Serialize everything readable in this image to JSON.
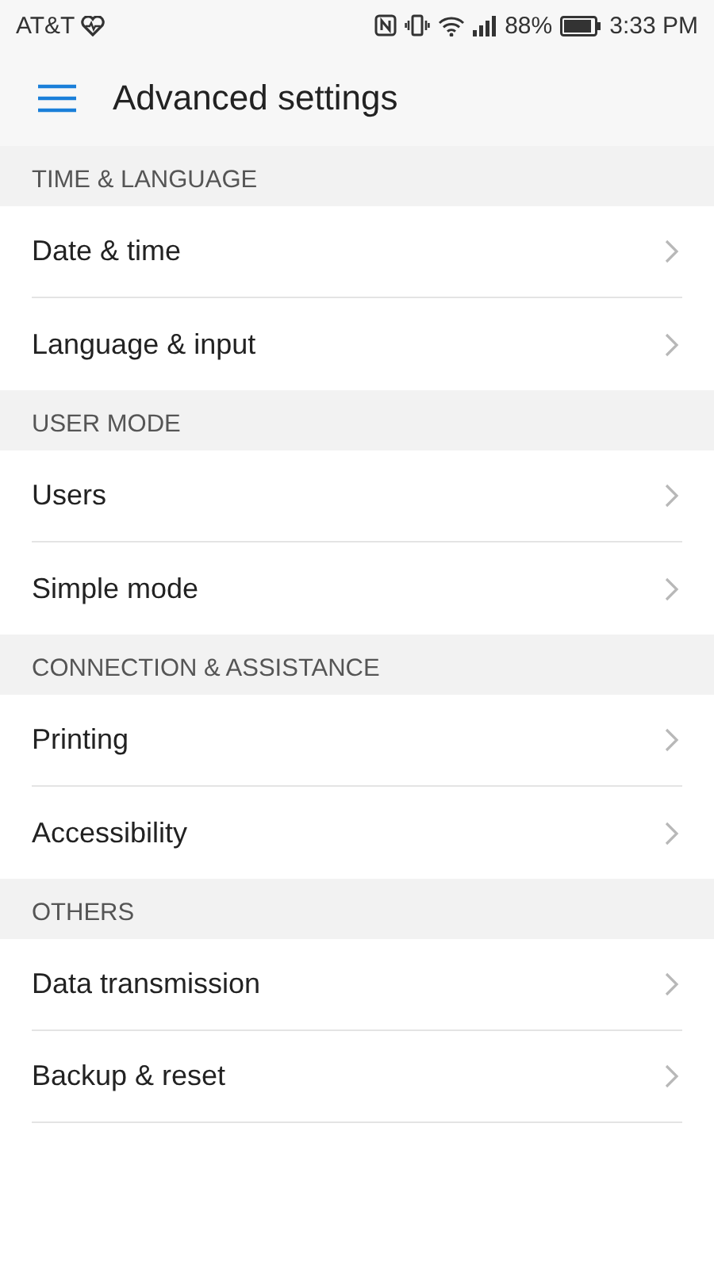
{
  "status_bar": {
    "carrier": "AT&T",
    "battery_percent": "88%",
    "time": "3:33 PM"
  },
  "header": {
    "title": "Advanced settings"
  },
  "sections": [
    {
      "title": "TIME & LANGUAGE",
      "items": [
        {
          "label": "Date & time"
        },
        {
          "label": "Language & input"
        }
      ]
    },
    {
      "title": "USER MODE",
      "items": [
        {
          "label": "Users"
        },
        {
          "label": "Simple mode"
        }
      ]
    },
    {
      "title": "CONNECTION & ASSISTANCE",
      "items": [
        {
          "label": "Printing"
        },
        {
          "label": "Accessibility"
        }
      ]
    },
    {
      "title": "OTHERS",
      "items": [
        {
          "label": "Data transmission"
        },
        {
          "label": "Backup & reset"
        }
      ]
    }
  ]
}
